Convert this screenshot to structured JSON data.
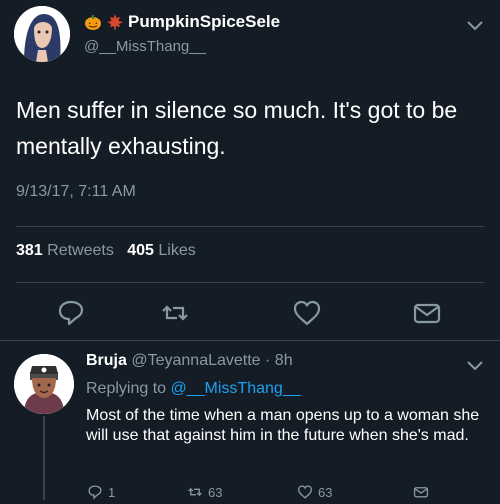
{
  "tweet": {
    "display_name": "PumpkinSpiceSele",
    "handle": "@__MissThang__",
    "text": "Men suffer in silence so much. It's got to be mentally exhausting.",
    "timestamp": "9/13/17, 7:11 AM",
    "retweets_count": "381",
    "retweets_label": "Retweets",
    "likes_count": "405",
    "likes_label": "Likes",
    "name_emojis": [
      "pumpkin-icon",
      "maple-leaf-icon"
    ]
  },
  "reply": {
    "display_name": "Bruja",
    "handle": "@TeyannaLavette",
    "time": "· 8h",
    "replying_prefix": "Replying to",
    "replying_mention": "@__MissThang__",
    "text": "Most of the time when a man opens up to a woman she will use that against him in the future when she's mad.",
    "reply_count": "1",
    "retweet_count": "63",
    "like_count": "63"
  },
  "colors": {
    "background": "#141d26",
    "secondary_text": "#8899a6",
    "accent": "#1da1f2",
    "divider": "#38444d"
  }
}
